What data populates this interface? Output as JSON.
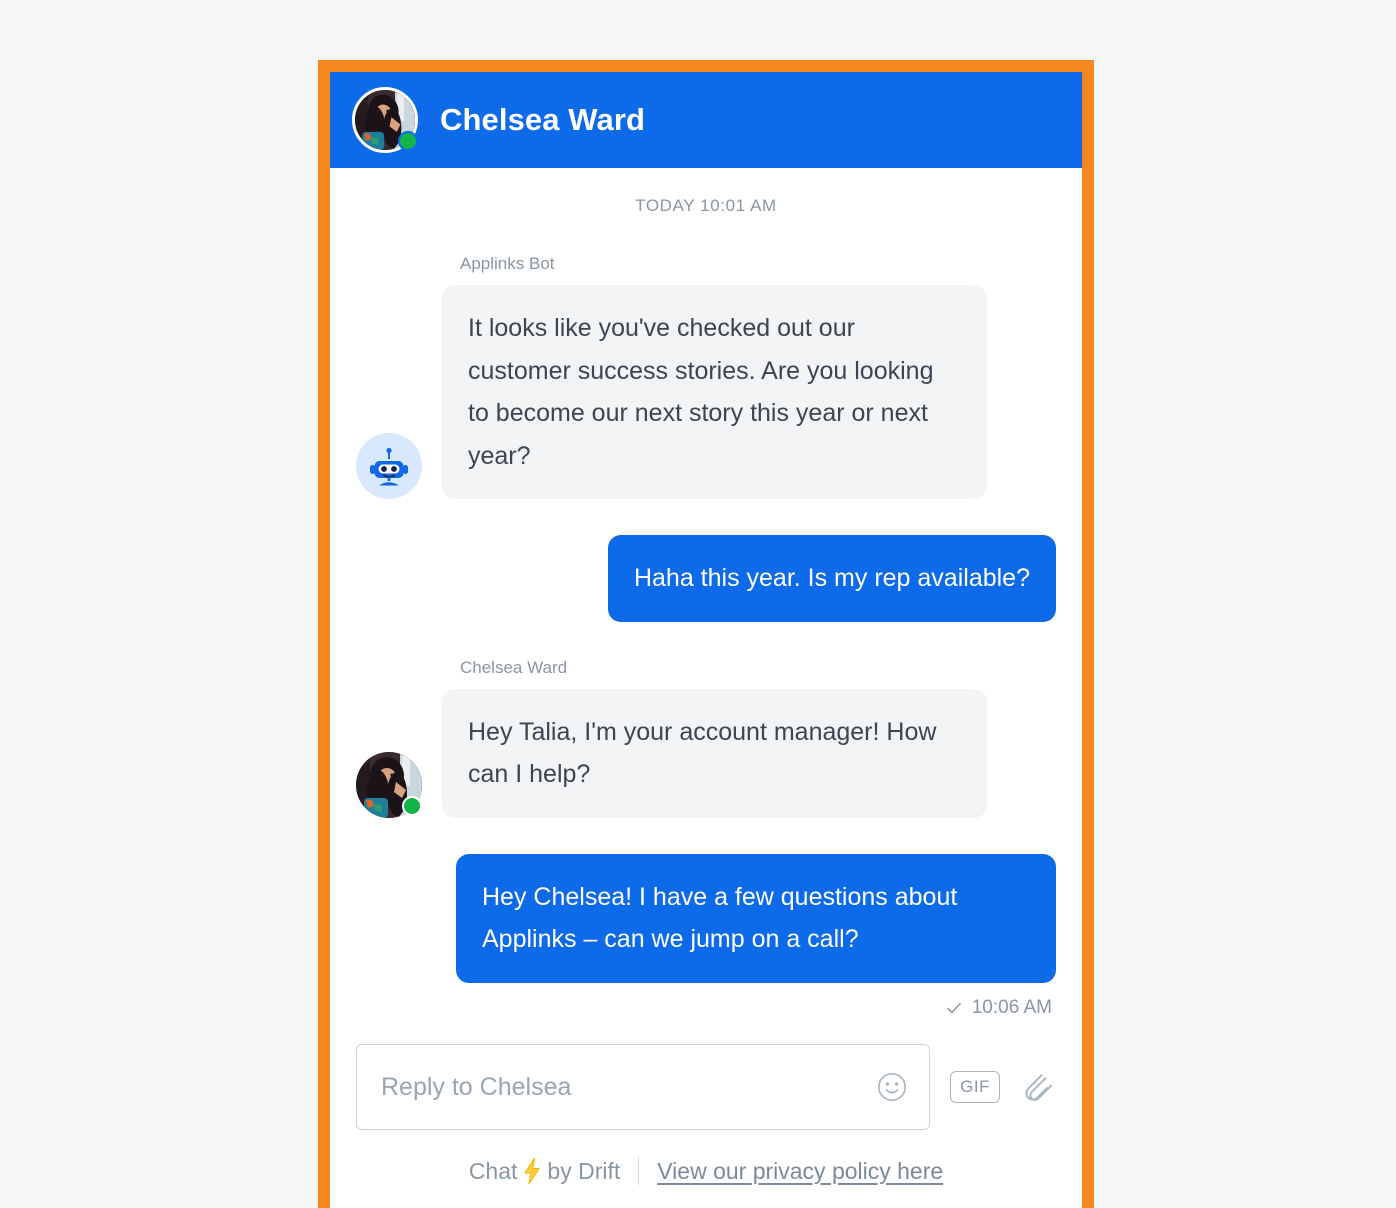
{
  "theme": {
    "frame_color": "#f7871f",
    "header_color": "#0d6ae8",
    "outgoing_bubble_color": "#0d6ae8",
    "incoming_bubble_color": "#f2f4f6",
    "online_dot_color": "#12b347",
    "page_background": "#f5f6f8",
    "muted_text_color": "#8a97a3"
  },
  "header": {
    "title": "Chelsea Ward",
    "avatar_alt": "Chelsea Ward",
    "presence": "online"
  },
  "conversation": {
    "day_divider": "TODAY 10:01 AM",
    "messages": [
      {
        "sender": "Applinks Bot",
        "avatar": "bot-icon",
        "direction": "incoming",
        "text": "It looks like you've checked out our customer success stories. Are you looking to become our next story this year or next year?"
      },
      {
        "sender": "",
        "direction": "outgoing",
        "text": "Haha this year. Is my rep available?"
      },
      {
        "sender": "Chelsea Ward",
        "avatar": "chelsea-photo",
        "direction": "incoming",
        "text": "Hey Talia, I'm your account manager! How can I help?"
      },
      {
        "sender": "",
        "direction": "outgoing",
        "text": "Hey Chelsea! I have a few questions about Applinks – can we jump on a call?"
      }
    ],
    "read_receipt": {
      "icon": "check-icon",
      "time": "10:06 AM"
    }
  },
  "composer": {
    "placeholder": "Reply to Chelsea",
    "value": "",
    "emoji_icon": "smiley-icon",
    "gif_label": "GIF",
    "attachment_icon": "paperclip-icon"
  },
  "footer": {
    "brand_prefix": "Chat",
    "brand_bolt": "⚡",
    "brand_suffix": "by Drift",
    "privacy_link": "View our privacy policy here"
  }
}
